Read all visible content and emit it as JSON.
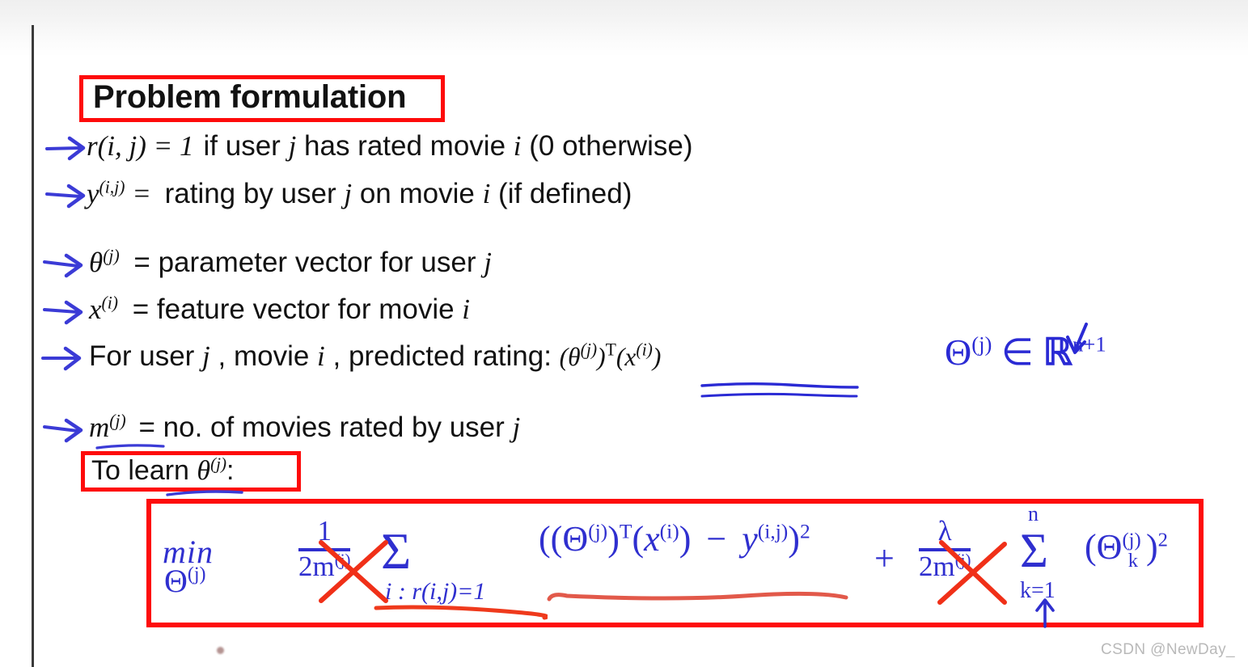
{
  "slide": {
    "title": "Problem formulation",
    "watermark": "CSDN @NewDay_"
  },
  "definitions": [
    {
      "id": "r-definition",
      "marker": "arrow-right-icon",
      "lhs": "r(i, j) = 1",
      "text": "if user j has rated movie i (0 otherwise)",
      "plain": "r(i,j) = 1 if user j has rated movie i (0 otherwise)"
    },
    {
      "id": "y-definition",
      "marker": "arrow-right-icon",
      "lhs": "y^(i,j) =",
      "text": "rating by user j on movie i (if defined)",
      "plain": "y(i,j) = rating by user j on movie i (if defined)"
    },
    {
      "id": "theta-definition",
      "marker": "arrow-right-icon",
      "lhs": "θ^(j) =",
      "text": "parameter vector for user j",
      "plain": "theta(j) = parameter vector for user j"
    },
    {
      "id": "x-definition",
      "marker": "arrow-right-icon",
      "lhs": "x^(i) =",
      "text": "feature vector for movie i",
      "plain": "x(i) = feature vector for movie i"
    },
    {
      "id": "prediction-definition",
      "marker": "arrow-right-icon",
      "lhs": "",
      "text": "For user j , movie i , predicted rating:",
      "plain": "For user j, movie i, predicted rating: (theta(j))T(x(i))"
    },
    {
      "id": "m-definition",
      "marker": "arrow-right-icon",
      "lhs": "m^(j) =",
      "text": "no. of movies rated by user j",
      "plain": "m(j) = no. of movies rated by user j"
    }
  ],
  "line_r": {
    "var": "r",
    "args": "(i, j)",
    "eq": " = ",
    "one": "1",
    "rest_a": "if user ",
    "j1": "j",
    "rest_b": " has rated movie ",
    "i1": "i",
    "rest_c": " (0 otherwise)"
  },
  "line_y": {
    "var": "y",
    "sup": "(i,j)",
    "eq": " = ",
    "rest_a": "rating by user ",
    "j1": "j",
    "rest_b": " on movie ",
    "i1": "i",
    "rest_c": " (if defined)"
  },
  "line_theta": {
    "var": "θ",
    "sup": "(j)",
    "eq": " = parameter vector for user ",
    "j1": "j"
  },
  "line_x": {
    "var": "x",
    "sup": "(i)",
    "eq": " = feature vector for movie ",
    "i1": "i"
  },
  "line_pred": {
    "lead": "For user ",
    "j1": "j",
    "mid": " , movie ",
    "i1": "i",
    "tail": " , predicted rating: ",
    "formula_open": "(",
    "theta": "θ",
    "theta_sup": "(j)",
    "formula_close": ")",
    "transpose": "T",
    "x_open": "(",
    "x": "x",
    "x_sup": "(i)",
    "x_close": ")"
  },
  "line_m": {
    "var": "m",
    "sup": "(j)",
    "eq": " = no. of movies rated by user ",
    "j1": "j"
  },
  "line_learn": {
    "text": "To learn ",
    "var": "θ",
    "sup": "(j)",
    "colon": ":"
  },
  "annotations": {
    "theta_in_R": {
      "theta": "Θ",
      "sup": "(j)",
      "in": " ∈ ",
      "reals": "ℝ",
      "dim": "n+1",
      "plain": "Θ(j) ∈ R^(n+1)",
      "color": "#2a2ad4"
    },
    "underline_prediction": "double-blue-underline",
    "underline_m": "blue-underline",
    "underline_to_learn": "blue-underline"
  },
  "cost_function": {
    "plain": "min_θ(j)  1/(2m^(j)) Σ_{i:r(i,j)=1} ((θ^(j))^T(x^(i)) − y^(i,j))^2  +  λ/(2m^(j)) Σ_{k=1}^{n} (θ_k^(j))^2",
    "min_label": "min",
    "min_sub_theta": "Θ",
    "min_sub_sup": "(j)",
    "frac1_num": "1",
    "frac1_den_a": "2",
    "frac1_den_b": "m",
    "frac1_den_sup": "(j)",
    "sigma": "Σ",
    "sigma_sub": "i : r(i,j)=1",
    "squared_term_open": "((",
    "squared_theta": "Θ",
    "squared_theta_sup": "(j)",
    "squared_transpose": "T",
    "squared_x": "x",
    "squared_x_sup": "(i)",
    "minus": " − ",
    "squared_y": "y",
    "squared_y_sup": "(i,j)",
    "squared_exp": "2",
    "plus": "+",
    "lambda": "λ",
    "frac2_den_a": "2",
    "frac2_den_b": "m",
    "frac2_den_sup": "(j)",
    "sigma2": "Σ",
    "sigma2_top": "n",
    "sigma2_sub": "k=1",
    "reg_open": "(",
    "reg_theta": "Θ",
    "reg_theta_sup": "(j)",
    "reg_theta_sub": "k",
    "reg_close": ")",
    "reg_exp": "2",
    "struck_out_terms": [
      "m^(j)",
      "m^(j)"
    ],
    "red_underlines": [
      "i : r(i,j)=1",
      "((Θ^(j))^T(x^(i)) − y^(i,j))^2"
    ],
    "up_arrow_under": "k=1"
  },
  "colors": {
    "highlight_red": "#fe0b0b",
    "hand_blue": "#2f2fcf",
    "arrow_blue": "#3b3bd6",
    "ink_black": "#121212",
    "watermark_gray": "#b9b9b9"
  }
}
